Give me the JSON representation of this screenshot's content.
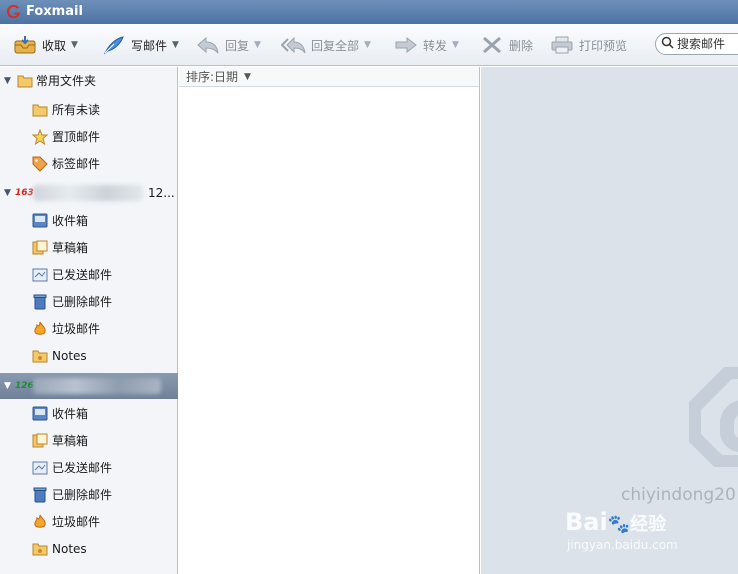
{
  "app": {
    "title": "Foxmail"
  },
  "toolbar": {
    "receive": "收取",
    "compose": "写邮件",
    "reply": "回复",
    "reply_all": "回复全部",
    "forward": "转发",
    "delete": "删除",
    "print_preview": "打印预览",
    "search_placeholder": "搜索邮件"
  },
  "sidebar": {
    "common": {
      "label": "常用文件夹",
      "items": [
        "所有未读",
        "置顶邮件",
        "标签邮件"
      ]
    },
    "accounts": [
      {
        "logo": "163",
        "name_suffix": "12...",
        "folders": [
          "收件箱",
          "草稿箱",
          "已发送邮件",
          "已删除邮件",
          "垃圾邮件",
          "Notes"
        ]
      },
      {
        "logo": "126",
        "name_suffix": "",
        "folders": [
          "收件箱",
          "草稿箱",
          "已发送邮件",
          "已删除邮件",
          "垃圾邮件",
          "Notes"
        ]
      }
    ]
  },
  "maillist": {
    "sort_label": "排序:日期"
  },
  "watermark": {
    "line1": "chiyindong20",
    "line2": "Bai",
    "line2b": "经验",
    "line3": "jingyan.baidu.com"
  },
  "colors": {
    "title_bar": "#5a7fae",
    "selected_account": "#7a8ca4",
    "preview_bg": "#dbe2ea"
  }
}
